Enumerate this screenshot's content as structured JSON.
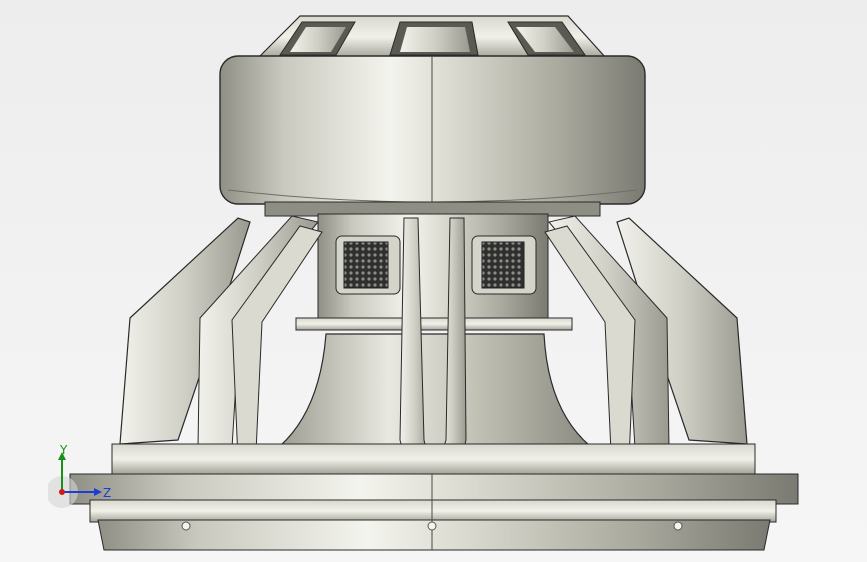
{
  "viewport": {
    "model": "subwoofer-speaker",
    "colors": {
      "background": "#f2f2f2",
      "metal_light": "#e9e9e2",
      "metal_mid": "#b9b9ae",
      "metal_dark": "#6e6e66",
      "edge": "#2a2a2a",
      "mesh": "#3a3a3a"
    }
  },
  "triad": {
    "y_label": "Y",
    "z_label": "Z",
    "y_color": "#1a8f1a",
    "z_color": "#1a3fd0",
    "x_color": "#d01a1a"
  }
}
